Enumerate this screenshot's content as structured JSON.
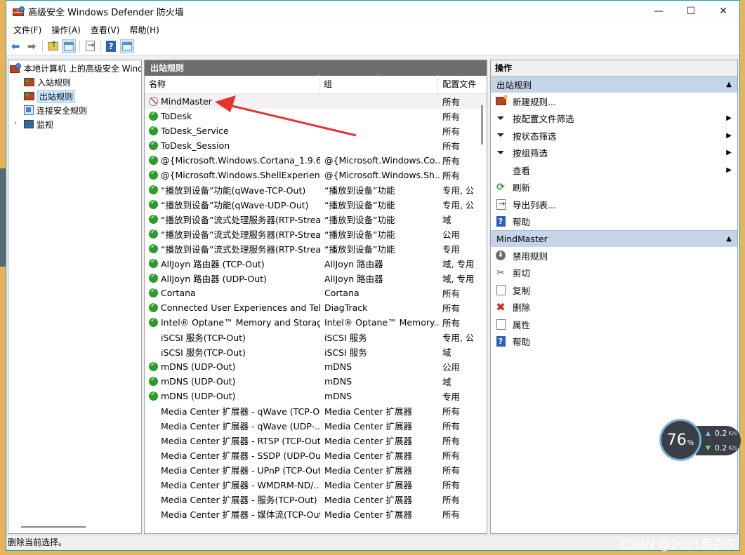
{
  "window": {
    "title": "高级安全 Windows Defender 防火墙",
    "controls": {
      "minimize": "—",
      "maximize": "☐",
      "close": "✕"
    }
  },
  "menu": [
    "文件(F)",
    "操作(A)",
    "查看(V)",
    "帮助(H)"
  ],
  "toolbar": {
    "icons": [
      "back-arrow-icon",
      "forward-arrow-icon",
      "up-folder-icon",
      "show-hide-tree-icon",
      "export-list-icon",
      "help-icon",
      "show-hide-action-pane-icon"
    ]
  },
  "tree": {
    "root": "本地计算机 上的高级安全 Windows Defender 防火墙",
    "items": [
      {
        "label": "入站规则"
      },
      {
        "label": "出站规则",
        "selected": true
      },
      {
        "label": "连接安全规则"
      },
      {
        "label": "监视",
        "expander": "›"
      }
    ]
  },
  "center": {
    "pane_title": "出站规则",
    "columns": [
      "名称",
      "组",
      "配置文件"
    ],
    "sort_caret": "^",
    "rows": [
      {
        "name": "MindMaster",
        "group": "",
        "profile": "所有",
        "status": "blocked",
        "highlight": true
      },
      {
        "name": "ToDesk",
        "group": "",
        "profile": "所有",
        "status": "ok"
      },
      {
        "name": "ToDesk_Service",
        "group": "",
        "profile": "所有",
        "status": "ok"
      },
      {
        "name": "ToDesk_Session",
        "group": "",
        "profile": "所有",
        "status": "ok"
      },
      {
        "name": "@{Microsoft.Windows.Cortana_1.9.6....",
        "group": "@{Microsoft.Windows.Co...",
        "profile": "所有",
        "status": "ok"
      },
      {
        "name": "@{Microsoft.Windows.ShellExperienc...",
        "group": "@{Microsoft.Windows.Sh...",
        "profile": "所有",
        "status": "ok"
      },
      {
        "name": "“播放到设备”功能(qWave-TCP-Out)",
        "group": "“播放到设备”功能",
        "profile": "专用, 公",
        "status": "ok"
      },
      {
        "name": "“播放到设备”功能(qWave-UDP-Out)",
        "group": "“播放到设备”功能",
        "profile": "专用, 公",
        "status": "ok"
      },
      {
        "name": "“播放到设备”流式处理服务器(RTP-Strea...",
        "group": "“播放到设备”功能",
        "profile": "域",
        "status": "ok"
      },
      {
        "name": "“播放到设备”流式处理服务器(RTP-Strea...",
        "group": "“播放到设备”功能",
        "profile": "公用",
        "status": "ok"
      },
      {
        "name": "“播放到设备”流式处理服务器(RTP-Strea...",
        "group": "“播放到设备”功能",
        "profile": "专用",
        "status": "ok"
      },
      {
        "name": "AllJoyn 路由器 (TCP-Out)",
        "group": "AllJoyn 路由器",
        "profile": "域, 专用",
        "status": "ok"
      },
      {
        "name": "AllJoyn 路由器 (UDP-Out)",
        "group": "AllJoyn 路由器",
        "profile": "域, 专用",
        "status": "ok"
      },
      {
        "name": "Cortana",
        "group": "Cortana",
        "profile": "所有",
        "status": "ok"
      },
      {
        "name": "Connected User Experiences and Tel...",
        "group": "DiagTrack",
        "profile": "所有",
        "status": "ok"
      },
      {
        "name": "Intel® Optane™ Memory and Storag...",
        "group": "Intel® Optane™ Memory...",
        "profile": "所有",
        "status": "ok"
      },
      {
        "name": "iSCSI 服务(TCP-Out)",
        "group": "iSCSI 服务",
        "profile": "专用, 公",
        "status": "none"
      },
      {
        "name": "iSCSI 服务(TCP-Out)",
        "group": "iSCSI 服务",
        "profile": "域",
        "status": "none"
      },
      {
        "name": "mDNS (UDP-Out)",
        "group": "mDNS",
        "profile": "公用",
        "status": "ok"
      },
      {
        "name": "mDNS (UDP-Out)",
        "group": "mDNS",
        "profile": "域",
        "status": "ok"
      },
      {
        "name": "mDNS (UDP-Out)",
        "group": "mDNS",
        "profile": "专用",
        "status": "ok"
      },
      {
        "name": "Media Center 扩展器 - qWave (TCP-O...",
        "group": "Media Center 扩展器",
        "profile": "所有",
        "status": "none"
      },
      {
        "name": "Media Center 扩展器 - qWave (UDP-...",
        "group": "Media Center 扩展器",
        "profile": "所有",
        "status": "none"
      },
      {
        "name": "Media Center 扩展器 - RTSP (TCP-Out)",
        "group": "Media Center 扩展器",
        "profile": "所有",
        "status": "none"
      },
      {
        "name": "Media Center 扩展器 - SSDP (UDP-Out)",
        "group": "Media Center 扩展器",
        "profile": "所有",
        "status": "none"
      },
      {
        "name": "Media Center 扩展器 - UPnP (TCP-Out)",
        "group": "Media Center 扩展器",
        "profile": "所有",
        "status": "none"
      },
      {
        "name": "Media Center 扩展器 - WMDRM-ND/...",
        "group": "Media Center 扩展器",
        "profile": "所有",
        "status": "none"
      },
      {
        "name": "Media Center 扩展器 - 服务(TCP-Out)",
        "group": "Media Center 扩展器",
        "profile": "所有",
        "status": "none"
      },
      {
        "name": "Media Center 扩展器 - 媒体流(TCP-Out)",
        "group": "Media Center 扩展器",
        "profile": "所有",
        "status": "none"
      }
    ]
  },
  "actions": {
    "header": "操作",
    "sections": [
      {
        "title": "出站规则",
        "collapse": "▲",
        "items": [
          {
            "label": "新建规则...",
            "icon": "new-rule-icon"
          },
          {
            "label": "按配置文件筛选",
            "icon": "filter-icon",
            "submenu": true
          },
          {
            "label": "按状态筛选",
            "icon": "filter-icon",
            "submenu": true
          },
          {
            "label": "按组筛选",
            "icon": "filter-icon",
            "submenu": true
          },
          {
            "label": "查看",
            "icon": "none",
            "submenu": true
          },
          {
            "label": "刷新",
            "icon": "refresh-icon"
          },
          {
            "label": "导出列表...",
            "icon": "export-list-icon"
          },
          {
            "label": "帮助",
            "icon": "help-icon"
          }
        ]
      },
      {
        "title": "MindMaster",
        "collapse": "▲",
        "items": [
          {
            "label": "禁用规则",
            "icon": "disable-rule-icon"
          },
          {
            "label": "剪切",
            "icon": "cut-icon"
          },
          {
            "label": "复制",
            "icon": "copy-icon"
          },
          {
            "label": "删除",
            "icon": "delete-icon"
          },
          {
            "label": "属性",
            "icon": "properties-icon"
          },
          {
            "label": "帮助",
            "icon": "help-icon"
          }
        ]
      }
    ]
  },
  "statusbar": {
    "text": "删除当前选择。"
  },
  "net_monitor": {
    "percent": "76",
    "percent_sign": "%",
    "up": "0.2",
    "down": "0.2",
    "unit": "K/s"
  },
  "watermark": "CSDN @2021黑白灰",
  "colors": {
    "annotation_arrow": "#e8322f",
    "selected_section": "#c5d5e8",
    "pane_header": "#6d6d6d"
  }
}
